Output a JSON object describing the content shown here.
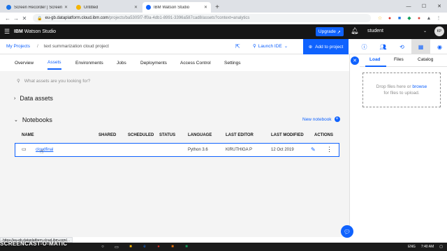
{
  "browser": {
    "tabs": [
      {
        "title": "Screen Recorder | Screencast-O",
        "favicon_color": "#1a73e8",
        "active": false
      },
      {
        "title": "Untitled",
        "favicon_color": "#f4b400",
        "active": false
      },
      {
        "title": "IBM Watson Studio",
        "favicon_color": "#0f62fe",
        "active": true
      }
    ],
    "new_tab": "+",
    "url_host": "eu-gb.dataplatform.cloud.ibm.com",
    "url_path": "/projects/ba5305f7-ff0a-4db1-8991-3396a587cad8/assets?context=analytics"
  },
  "header": {
    "brand_bold": "IBM",
    "brand_rest": " Watson Studio",
    "upgrade_label": "Upgrade",
    "user_name": "student",
    "avatar_initials": "KP"
  },
  "project": {
    "breadcrumb_root": "My Projects",
    "separator": "/",
    "project_name": "text summarization cloud project",
    "launch_label": "Launch IDE",
    "add_label": "Add to project"
  },
  "tabs": [
    "Overview",
    "Assets",
    "Environments",
    "Jobs",
    "Deployments",
    "Access Control",
    "Settings"
  ],
  "active_tab": "Assets",
  "assets": {
    "search_placeholder": "What assets are you looking for?",
    "data_assets_title": "Data assets",
    "notebooks_title": "Notebooks",
    "new_notebook_label": "New notebook",
    "columns": [
      "NAME",
      "SHARED",
      "SCHEDULED",
      "STATUS",
      "LANGUAGE",
      "LAST EDITOR",
      "LAST MODIFIED",
      "ACTIONS"
    ],
    "rows": [
      {
        "name": "cloudfinal",
        "shared": "",
        "scheduled": "",
        "status": "",
        "language": "Python 3.6",
        "last_editor": "KIRUTHIGA P",
        "last_modified": "12 Oct 2019"
      }
    ]
  },
  "panel": {
    "tabs": [
      "Load",
      "Files",
      "Catalog"
    ],
    "drop_line1": "Drop files here or",
    "drop_browse": "browse",
    "drop_line2": "for files to upload."
  },
  "status_url": "https://eu-gb.dataplatform.cloud.ibm.com/...",
  "watermark": "SCREENCAST-O-MATIC",
  "taskbar": {
    "lang": "ENG",
    "time": "7:40 AM"
  }
}
